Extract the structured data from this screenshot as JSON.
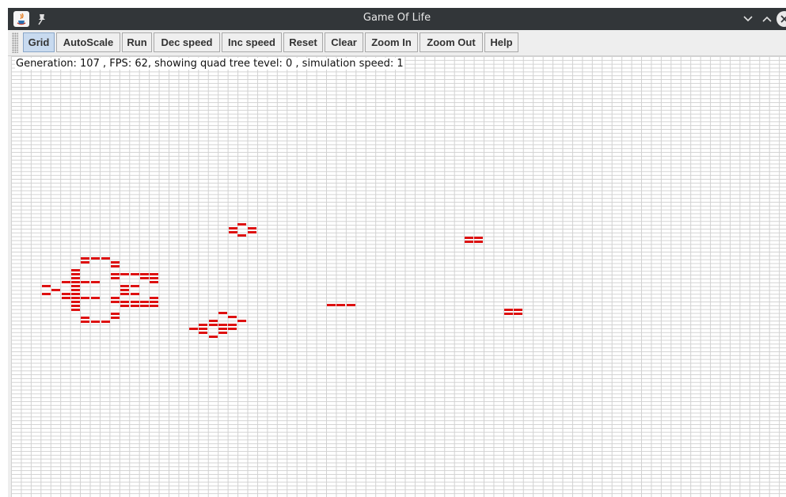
{
  "window": {
    "title": "Game Of Life"
  },
  "toolbar": {
    "buttons": [
      {
        "label": "Grid",
        "active": true
      },
      {
        "label": "AutoScale",
        "active": false
      },
      {
        "label": "Run",
        "active": false
      },
      {
        "label": "Dec speed",
        "active": false
      },
      {
        "label": "Inc speed",
        "active": false
      },
      {
        "label": "Reset",
        "active": false
      },
      {
        "label": "Clear",
        "active": false
      },
      {
        "label": "Zoom In",
        "active": false
      },
      {
        "label": "Zoom Out",
        "active": false
      },
      {
        "label": "Help",
        "active": false
      }
    ]
  },
  "status": {
    "text": "Generation: 107 , FPS: 62, showing quad tree tevel: 0 , simulation speed: 1"
  },
  "colors": {
    "live_cell": "#dd1111",
    "grid_line": "#d2d2d2",
    "titlebar": "#323639"
  }
}
